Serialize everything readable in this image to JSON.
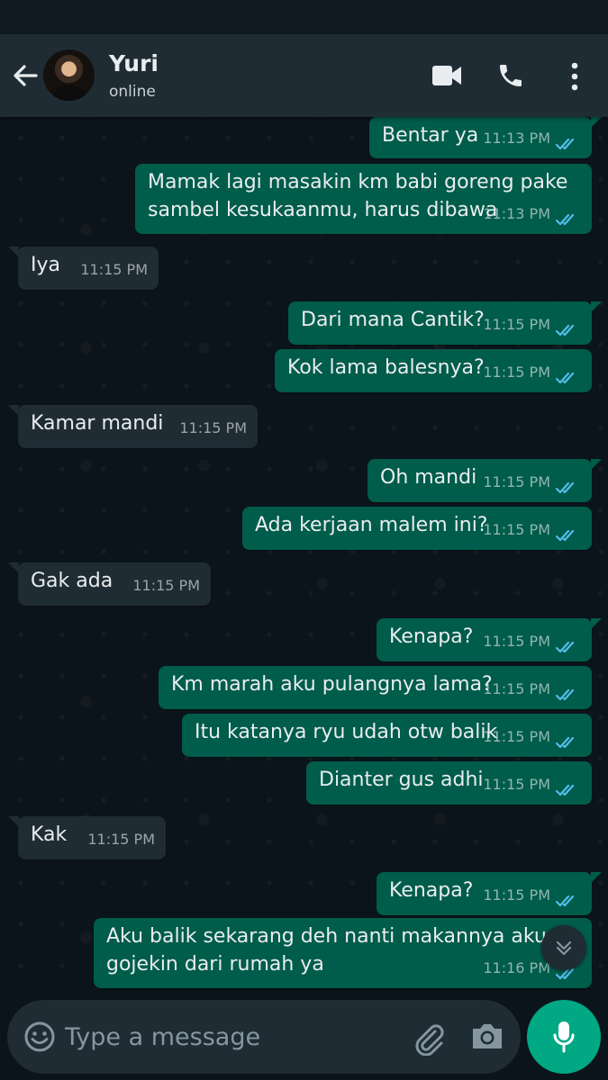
{
  "header": {
    "contact_name": "Yuri",
    "contact_status": "online",
    "icons": [
      "back-arrow-icon",
      "video-call-icon",
      "voice-call-icon",
      "more-options-icon"
    ]
  },
  "colors": {
    "outgoing_bubble": "#005c4b",
    "incoming_bubble": "#1f2c34",
    "read_ticks": "#53bdeb",
    "accent": "#00a884"
  },
  "messages": [
    {
      "text": "Bentar ya",
      "time": "11:13 PM",
      "dir": "out",
      "read": true
    },
    {
      "text": "Mamak lagi masakin km babi goreng pake\nsambel kesukaanmu, harus dibawa",
      "time": "11:13 PM",
      "dir": "out",
      "read": true
    },
    {
      "text": "Iya",
      "time": "11:15 PM",
      "dir": "in"
    },
    {
      "text": "Dari mana Cantik?",
      "time": "11:15 PM",
      "dir": "out",
      "read": true
    },
    {
      "text": "Kok lama balesnya?",
      "time": "11:15 PM",
      "dir": "out",
      "read": true
    },
    {
      "text": "Kamar mandi",
      "time": "11:15 PM",
      "dir": "in"
    },
    {
      "text": "Oh mandi",
      "time": "11:15 PM",
      "dir": "out",
      "read": true
    },
    {
      "text": "Ada kerjaan malem ini?",
      "time": "11:15 PM",
      "dir": "out",
      "read": true
    },
    {
      "text": "Gak ada",
      "time": "11:15 PM",
      "dir": "in"
    },
    {
      "text": "Kenapa?",
      "time": "11:15 PM",
      "dir": "out",
      "read": true
    },
    {
      "text": "Km marah aku pulangnya lama?",
      "time": "11:15 PM",
      "dir": "out",
      "read": true
    },
    {
      "text": "Itu katanya ryu udah otw balik",
      "time": "11:15 PM",
      "dir": "out",
      "read": true
    },
    {
      "text": "Dianter gus adhi",
      "time": "11:15 PM",
      "dir": "out",
      "read": true
    },
    {
      "text": "Kak",
      "time": "11:15 PM",
      "dir": "in"
    },
    {
      "text": "Kenapa?",
      "time": "11:15 PM",
      "dir": "out",
      "read": true
    },
    {
      "text": "Aku balik sekarang deh nanti makannya aku\ngojekin dari rumah ya",
      "time": "11:16 PM",
      "dir": "out",
      "read": true
    }
  ],
  "composer": {
    "placeholder": "Type a message",
    "icons": [
      "emoji-icon",
      "attach-icon",
      "camera-icon",
      "mic-icon"
    ]
  }
}
